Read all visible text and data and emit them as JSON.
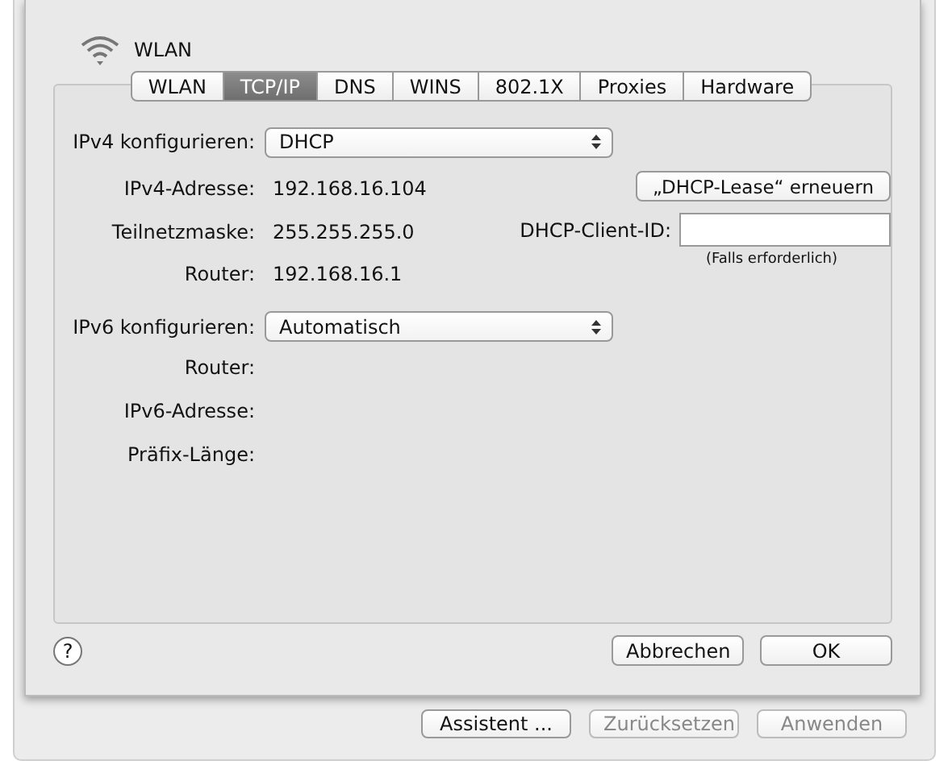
{
  "window": {
    "title": "WLAN"
  },
  "tabs": [
    {
      "label": "WLAN",
      "selected": false
    },
    {
      "label": "TCP/IP",
      "selected": true
    },
    {
      "label": "DNS",
      "selected": false
    },
    {
      "label": "WINS",
      "selected": false
    },
    {
      "label": "802.1X",
      "selected": false
    },
    {
      "label": "Proxies",
      "selected": false
    },
    {
      "label": "Hardware",
      "selected": false
    }
  ],
  "ipv4": {
    "label": "IPv4 konfigurieren:",
    "value": "DHCP"
  },
  "ipv4_rows": [
    {
      "label": "IPv4-Adresse:",
      "value": "192.168.16.104"
    },
    {
      "label": "Teilnetzmaske:",
      "value": "255.255.255.0"
    },
    {
      "label": "Router:",
      "value": "192.168.16.1"
    }
  ],
  "renew_button": "„DHCP-Lease“ erneuern",
  "client_id": {
    "label": "DHCP-Client-ID:",
    "hint": "(Falls erforderlich)"
  },
  "ipv6": {
    "label": "IPv6 konfigurieren:",
    "value": "Automatisch"
  },
  "ipv6_rows": [
    {
      "label": "Router:"
    },
    {
      "label": "IPv6-Adresse:"
    },
    {
      "label": "Präfix-Länge:"
    }
  ],
  "help_button": "?",
  "sheet_buttons": [
    {
      "label": "Abbrechen"
    },
    {
      "label": "OK"
    }
  ],
  "window_buttons": [
    {
      "label": "Assistent ...",
      "disabled": false
    },
    {
      "label": "Zurücksetzen",
      "disabled": true
    },
    {
      "label": "Anwenden",
      "disabled": true
    }
  ]
}
